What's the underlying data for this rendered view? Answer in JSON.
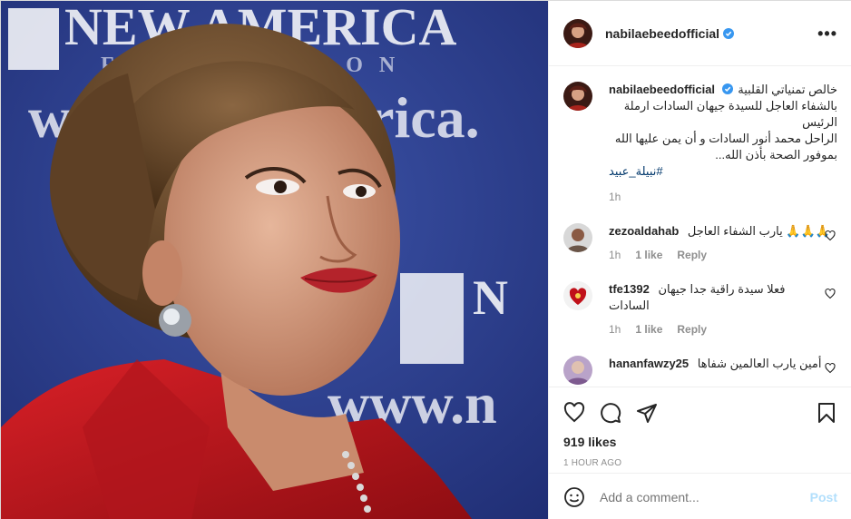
{
  "photo": {
    "banner_text_top": "NEW AMERICA",
    "banner_text_mid": "www.newamerica.",
    "banner_sub": "FOUNDATION",
    "colors": {
      "banner": "#2c3d8f",
      "jacket": "#c2141b",
      "hair": "#6b4a2c",
      "skin": "#d9a184"
    }
  },
  "header": {
    "username": "nabilaebeedofficial",
    "verified_icon": "verified-badge-icon",
    "more_icon": "more-options-icon",
    "more_text": "•••"
  },
  "caption": {
    "username": "nabilaebeedofficial",
    "lines": [
      "خالص تمنياتي القلبية",
      "بالشفاء العاجل للسيدة جيهان السادات ارملة الرئيس",
      "الراحل محمد أنور السادات و أن يمن عليها الله",
      "بموفور الصحة بأذن الله...",
      "#نبيلة_عبيد"
    ],
    "time": "1h"
  },
  "comments": [
    {
      "username": "zezoaldahab",
      "text": "يارب الشفاء العاجل 🙏🙏🙏",
      "time": "1h",
      "likes": "1 like",
      "reply": "Reply"
    },
    {
      "username": "tfe1392",
      "text": "فعلا سيدة راقية جدا جيهان",
      "text2": "السادات",
      "time": "1h",
      "likes": "1 like",
      "reply": "Reply"
    },
    {
      "username": "hananfawzy25",
      "text": "أمين يارب العالمين شفاها"
    }
  ],
  "actions": {
    "like_icon": "heart-icon",
    "comment_icon": "comment-icon",
    "share_icon": "paper-plane-icon",
    "save_icon": "bookmark-icon",
    "likes_count": "919 likes",
    "time_ago": "1 HOUR AGO"
  },
  "add_comment": {
    "placeholder": "Add a comment...",
    "post_label": "Post",
    "emoji_icon": "emoji-smile-icon"
  }
}
